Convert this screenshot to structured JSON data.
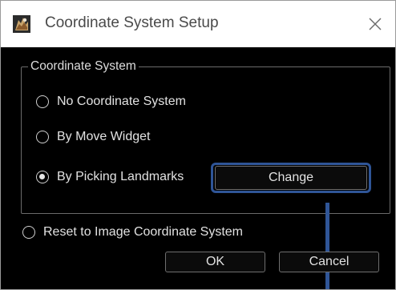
{
  "window": {
    "title": "Coordinate System Setup",
    "close_symbol": "✕",
    "app_icon": "app-logo-icon"
  },
  "coordinate_group": {
    "title": "Coordinate System",
    "options": [
      {
        "label": "No Coordinate System",
        "selected": false
      },
      {
        "label": "By Move Widget",
        "selected": false
      },
      {
        "label": "By Picking Landmarks",
        "selected": true
      }
    ],
    "change_button": "Change"
  },
  "reset_option": {
    "label": "Reset to Image Coordinate System",
    "selected": false
  },
  "footer": {
    "ok_button": "OK",
    "cancel_button": "Cancel"
  },
  "colors": {
    "dialog_background": "#000000",
    "titlebar_background": "#ffffff",
    "annotation_highlight": "#2f5597"
  }
}
